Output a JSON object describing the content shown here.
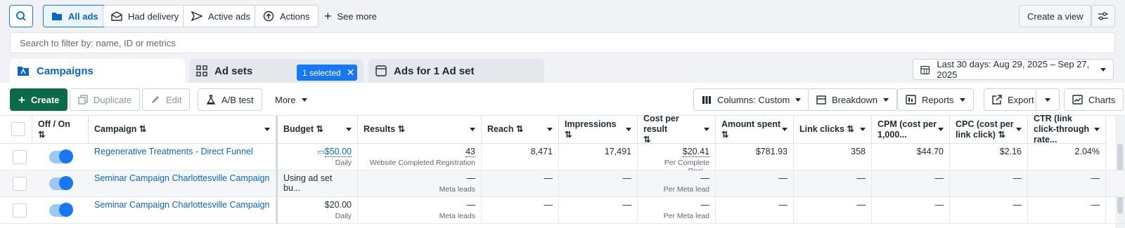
{
  "filters": {
    "all_ads": "All ads",
    "had_delivery": "Had delivery",
    "active_ads": "Active ads",
    "actions": "Actions",
    "see_more": "See more",
    "create_view": "Create a view"
  },
  "search": {
    "placeholder": "Search to filter by: name, ID or metrics"
  },
  "tabs": {
    "campaigns": "Campaigns",
    "ad_sets": "Ad sets",
    "selected": "1 selected",
    "ads": "Ads for 1 Ad set"
  },
  "date_range": "Last 30 days: Aug 29, 2025 – Sep 27, 2025",
  "toolbar": {
    "create": "Create",
    "duplicate": "Duplicate",
    "edit": "Edit",
    "ab_test": "A/B test",
    "more": "More",
    "columns": "Columns: Custom",
    "breakdown": "Breakdown",
    "reports": "Reports",
    "export": "Export",
    "charts": "Charts"
  },
  "columns": {
    "off_on": "Off / On",
    "campaign": "Campaign",
    "budget": "Budget",
    "results": "Results",
    "reach": "Reach",
    "impressions": "Impressions",
    "cost_per_result": "Cost per result",
    "amount_spent": "Amount spent",
    "link_clicks": "Link clicks",
    "cpm": "CPM (cost per 1,000...",
    "cpc": "CPC (cost per link click)",
    "ctr": "CTR (link click-through rate..."
  },
  "rows": [
    {
      "campaign": "Regenerative Treatments - Direct Funnel",
      "budget": "$50.00",
      "budget_sub": "Daily",
      "results": "43",
      "results_sub": "Website Completed Registration",
      "reach": "8,471",
      "impressions": "17,491",
      "cost": "$20.41",
      "cost_sub": "Per Complete Regi...",
      "spent": "$781.93",
      "clicks": "358",
      "cpm": "$44.70",
      "cpc": "$2.16",
      "ctr": "2.04%"
    },
    {
      "campaign": "Seminar Campaign Charlottesville Campaign",
      "budget": "Using ad set bu...",
      "budget_sub": "",
      "results": "—",
      "results_sub": "Meta leads",
      "reach": "—",
      "impressions": "—",
      "cost": "—",
      "cost_sub": "Per Meta lead",
      "spent": "—",
      "clicks": "—",
      "cpm": "—",
      "cpc": "—",
      "ctr": "—"
    },
    {
      "campaign": "Seminar Campaign Charlottesville Campaign",
      "budget": "$20.00",
      "budget_sub": "Daily",
      "results": "—",
      "results_sub": "Meta leads",
      "reach": "—",
      "impressions": "—",
      "cost": "—",
      "cost_sub": "Per Meta lead",
      "spent": "—",
      "clicks": "—",
      "cpm": "—",
      "cpc": "—",
      "ctr": "—"
    }
  ],
  "colors": {
    "accent": "#1877f2",
    "create": "#0b6b48"
  },
  "icons": [
    "search-icon",
    "folder-icon",
    "envelope-icon",
    "send-icon",
    "upload-icon",
    "plus-icon",
    "sliders-icon",
    "grid-icon",
    "window-icon",
    "calendar-icon",
    "copy-icon",
    "pencil-icon",
    "flask-icon",
    "columns-icon",
    "breakdown-icon",
    "reports-icon",
    "export-icon",
    "chart-icon",
    "sort-icon",
    "chevron-down-icon"
  ]
}
